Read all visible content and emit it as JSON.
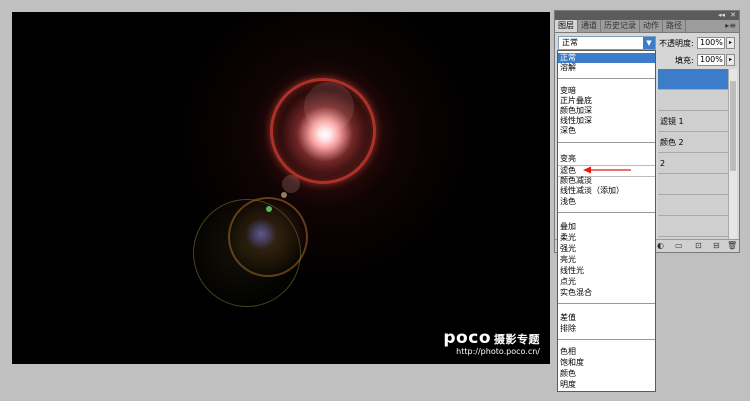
{
  "photo": {
    "watermark_brand": "poco",
    "watermark_sub": "摄影专题",
    "watermark_url": "http://photo.poco.cn/"
  },
  "panel": {
    "controls": [
      "◂◂",
      "✕"
    ],
    "tabs": [
      "图层",
      "通道",
      "历史记录",
      "动作",
      "路径"
    ],
    "tab_menu": "▸≡",
    "blend_mode_value": "正常",
    "opacity_label": "不透明度:",
    "opacity_value": "100%",
    "fill_label": "填充:",
    "fill_value": "100%",
    "layer_fragments": [
      "滤镜 1",
      "颜色 2",
      "2"
    ],
    "bottom_icons": [
      "◐",
      "▭",
      "⊡",
      "⊟",
      "🗑"
    ]
  },
  "blend_modes": {
    "items": [
      [
        "正常",
        "溶解"
      ],
      [
        "变暗",
        "正片叠底",
        "颜色加深",
        "线性加深",
        "深色"
      ],
      [
        "变亮",
        "滤色",
        "颜色减淡",
        "线性减淡（添加）",
        "浅色"
      ],
      [
        "叠加",
        "柔光",
        "强光",
        "亮光",
        "线性光",
        "点光",
        "实色混合"
      ],
      [
        "差值",
        "排除"
      ],
      [
        "色相",
        "饱和度",
        "颜色",
        "明度"
      ]
    ],
    "selected": "正常",
    "highlighted_by_arrow": "滤色"
  },
  "colors": {
    "selection": "#3d7cc9",
    "arrow": "#e21a1a"
  }
}
